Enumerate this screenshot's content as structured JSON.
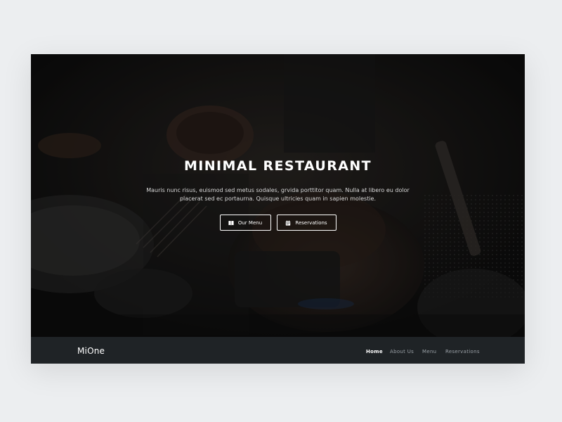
{
  "hero": {
    "title": "MINIMAL RESTAURANT",
    "description": "Mauris nunc risus, euismod sed metus sodales, grvida porttitor quam. Nulla at libero eu dolor placerat sed ec portaurna. Quisque ultricies quam in sapien molestie.",
    "buttons": [
      {
        "label": "Our Menu",
        "icon": "book-icon"
      },
      {
        "label": "Reservations",
        "icon": "calendar-icon"
      }
    ]
  },
  "navbar": {
    "brand": "MiOne",
    "links": [
      {
        "label": "Home",
        "active": true
      },
      {
        "label": "About Us",
        "active": false
      },
      {
        "label": "Menu",
        "active": false
      },
      {
        "label": "Reservations",
        "active": false
      }
    ]
  },
  "colors": {
    "page_background": "#eceef0",
    "navbar_background": "#1f2326",
    "hero_background": "#121212",
    "text_primary": "#ffffff",
    "nav_inactive": "#9aa0a6"
  }
}
